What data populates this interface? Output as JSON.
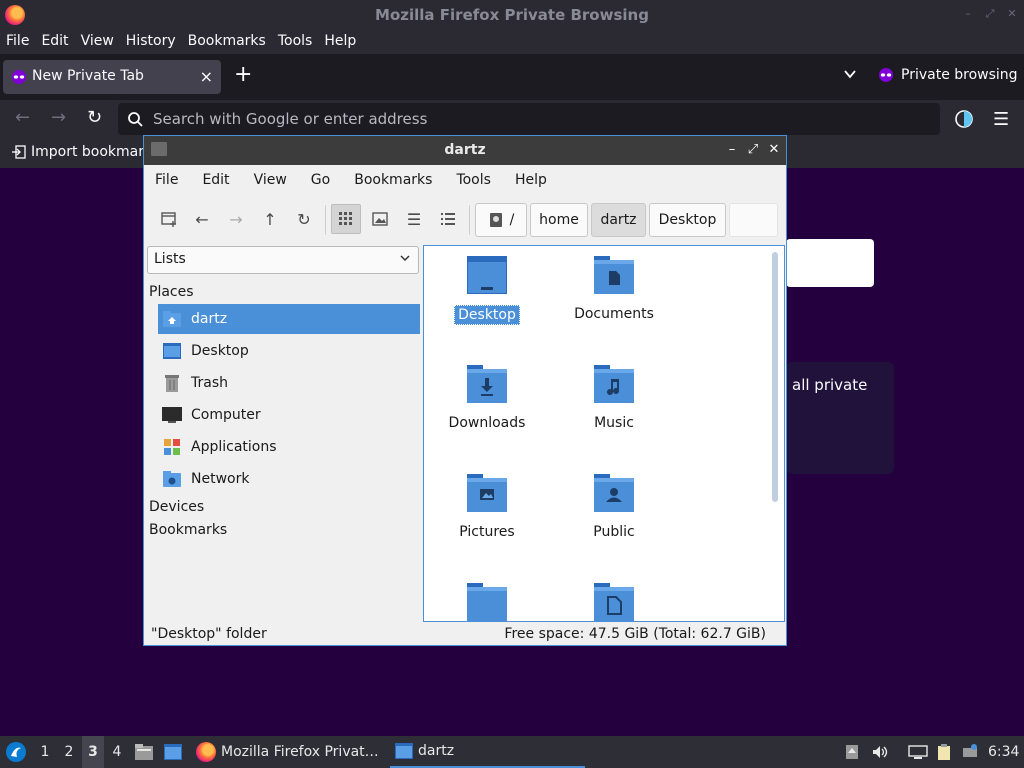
{
  "firefox": {
    "window_title": "Mozilla Firefox Private Browsing",
    "menu": [
      "File",
      "Edit",
      "View",
      "History",
      "Bookmarks",
      "Tools",
      "Help"
    ],
    "tab_label": "New Private Tab",
    "tab_close": "×",
    "new_tab": "+",
    "tab_list": "⌄",
    "private_indicator": "Private browsing",
    "url_placeholder": "Search with Google or enter address",
    "bookmark_item": "Import bookmark",
    "page_text_private": "all private"
  },
  "file_manager": {
    "window_title": "dartz",
    "menu": [
      "File",
      "Edit",
      "View",
      "Go",
      "Bookmarks",
      "Tools",
      "Help"
    ],
    "breadcrumbs": [
      "/",
      "home",
      "dartz",
      "Desktop"
    ],
    "side_mode": "Lists",
    "sections": {
      "places": "Places",
      "devices": "Devices",
      "bookmarks": "Bookmarks"
    },
    "places": [
      {
        "label": "dartz",
        "icon": "home-folder-icon",
        "selected": true
      },
      {
        "label": "Desktop",
        "icon": "desktop-icon"
      },
      {
        "label": "Trash",
        "icon": "trash-icon"
      },
      {
        "label": "Computer",
        "icon": "computer-icon"
      },
      {
        "label": "Applications",
        "icon": "applications-icon"
      },
      {
        "label": "Network",
        "icon": "network-icon"
      }
    ],
    "files": [
      {
        "label": "Desktop",
        "icon": "desktop-folder-icon",
        "selected": true
      },
      {
        "label": "Documents",
        "icon": "documents-folder-icon"
      },
      {
        "label": "Downloads",
        "icon": "downloads-folder-icon"
      },
      {
        "label": "Music",
        "icon": "music-folder-icon"
      },
      {
        "label": "Pictures",
        "icon": "pictures-folder-icon"
      },
      {
        "label": "Public",
        "icon": "public-folder-icon"
      },
      {
        "label": "",
        "icon": "folder-icon"
      },
      {
        "label": "",
        "icon": "templates-folder-icon"
      }
    ],
    "status_left": "\"Desktop\" folder",
    "status_right": "Free space: 47.5 GiB (Total: 62.7 GiB)"
  },
  "taskbar": {
    "workspaces": [
      "1",
      "2",
      "3",
      "4"
    ],
    "active_workspace": "3",
    "tasks": [
      "Mozilla Firefox Privat…",
      "dartz"
    ],
    "clock": "6:34"
  },
  "colors": {
    "accent": "#4a90d9",
    "page_bg": "#25003e",
    "folder_blue": "#4a8fd8"
  }
}
